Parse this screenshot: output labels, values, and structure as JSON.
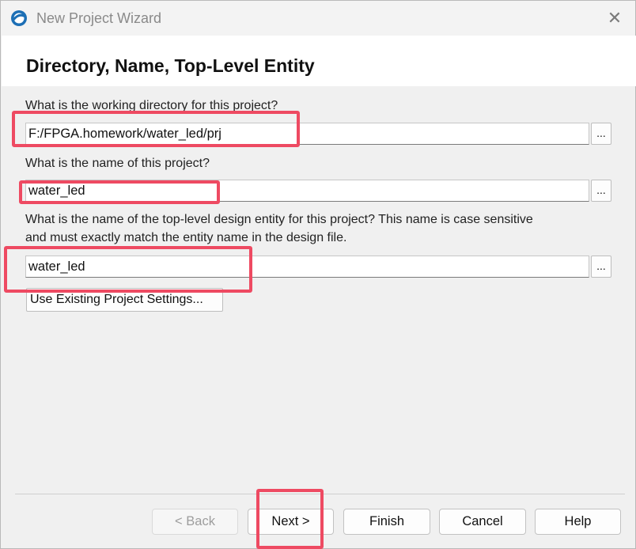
{
  "window": {
    "title": "New Project Wizard",
    "close_glyph": "✕"
  },
  "page": {
    "heading": "Directory, Name, Top-Level Entity"
  },
  "fields": {
    "directory_label": "What is the working directory for this project?",
    "directory_value": "F:/FPGA.homework/water_led/prj",
    "name_label": "What is the name of this project?",
    "name_value": "water_led",
    "entity_label_line1": "What is the name of the top-level design entity for this project? This name is case sensitive",
    "entity_label_line2": "and must exactly match the entity name in the design file.",
    "entity_value": "water_led",
    "browse_label": "..."
  },
  "buttons": {
    "use_existing": "Use Existing Project Settings...",
    "back": "< Back",
    "next": "Next >",
    "finish": "Finish",
    "cancel": "Cancel",
    "help": "Help"
  },
  "colors": {
    "highlight": "#ee4a62",
    "icon_blue": "#1c6fb5"
  }
}
